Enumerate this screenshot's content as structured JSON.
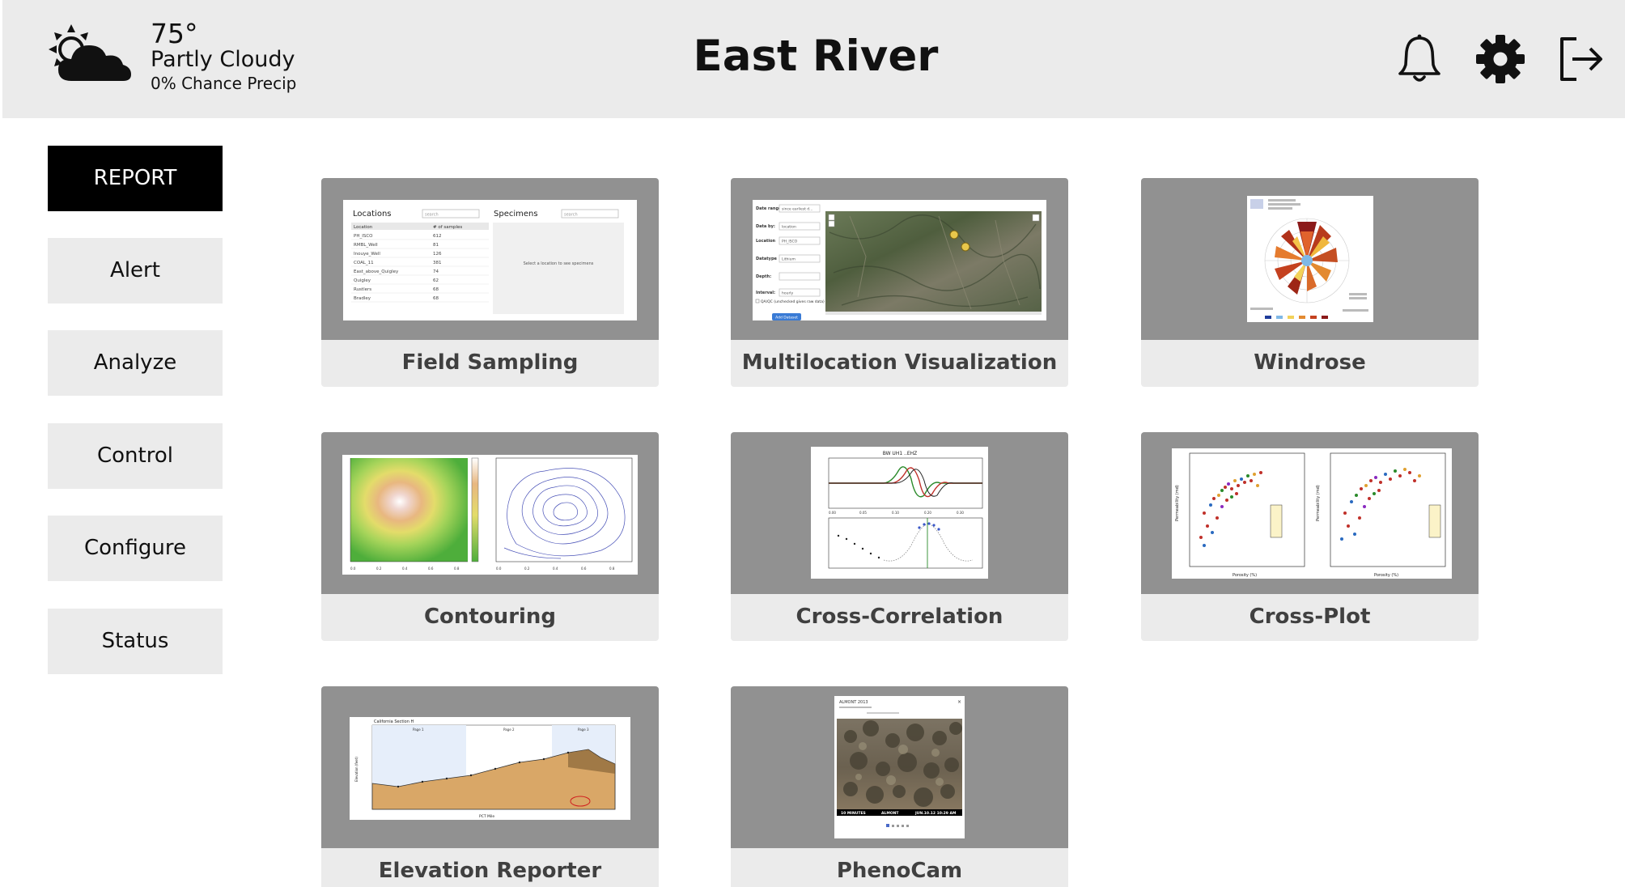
{
  "header": {
    "weather": {
      "icon": "partly-cloudy-icon",
      "temperature": "75°",
      "condition": "Partly Cloudy",
      "precip": "0% Chance Precip"
    },
    "title": "East River",
    "actions": [
      {
        "icon": "bell-icon",
        "label": "Notifications"
      },
      {
        "icon": "gear-icon",
        "label": "Settings"
      },
      {
        "icon": "logout-icon",
        "label": "Log out"
      }
    ]
  },
  "sidebar": {
    "items": [
      {
        "label": "REPORT",
        "active": true
      },
      {
        "label": "Alert",
        "active": false
      },
      {
        "label": "Analyze",
        "active": false
      },
      {
        "label": "Control",
        "active": false
      },
      {
        "label": "Configure",
        "active": false
      },
      {
        "label": "Status",
        "active": false
      }
    ]
  },
  "tiles": [
    {
      "label": "Field Sampling",
      "preview": {
        "locations_title": "Locations",
        "specimens_title": "Specimens",
        "search_placeholder": "search",
        "col_location": "Location",
        "col_samples": "# of samples",
        "rows": [
          [
            "PH_ISCO",
            "612"
          ],
          [
            "RMBL_Well",
            "81"
          ],
          [
            "Inouye_Well",
            "126"
          ],
          [
            "COAL_11",
            "381"
          ],
          [
            "East_above_Quigley",
            "74"
          ],
          [
            "Quigley",
            "62"
          ],
          [
            "Rustlers",
            "68"
          ],
          [
            "Bradley",
            "68"
          ]
        ],
        "specimens_hint": "Select a location to see specimens"
      }
    },
    {
      "label": "Multilocation Visualization",
      "preview": {
        "fields": [
          {
            "label": "Date range:",
            "value": "since earliest d..."
          },
          {
            "label": "Data by:",
            "value": "location"
          },
          {
            "label": "Location",
            "value": "PH_ISCO"
          },
          {
            "label": "Datatype",
            "value": "Lithium"
          },
          {
            "label": "Depth:",
            "value": ""
          },
          {
            "label": "Interval:",
            "value": "hourly"
          }
        ],
        "checkbox_label": "QA/QC (unchecked gives raw data)",
        "button_label": "Add Dataset"
      }
    },
    {
      "label": "Windrose"
    },
    {
      "label": "Contouring"
    },
    {
      "label": "Cross-Correlation",
      "preview": {
        "chart_title": "BW UH1 ..EHZ"
      }
    },
    {
      "label": "Cross-Plot",
      "preview": {
        "y_title": "Permeability (md)",
        "x_title": "Porosity (%)"
      }
    },
    {
      "label": "Elevation Reporter",
      "preview": {
        "chart_title": "California Section H",
        "pages": [
          "Page 1",
          "Page 2",
          "Page 3"
        ],
        "y_title": "Elevation (feet)",
        "x_title": "PCT Mile"
      }
    },
    {
      "label": "PhenoCam",
      "preview": {
        "site": "ALMONT 2013",
        "stamp_interval": "10 MINUTES",
        "stamp_site": "ALMONT",
        "stamp_date": "JUN.10.12  10:29 AM"
      }
    }
  ],
  "colors": {
    "header_bg": "#ebebeb",
    "nav_active_bg": "#000000",
    "tile_image_bg": "#919191",
    "tile_label_bg": "#ebebeb"
  }
}
